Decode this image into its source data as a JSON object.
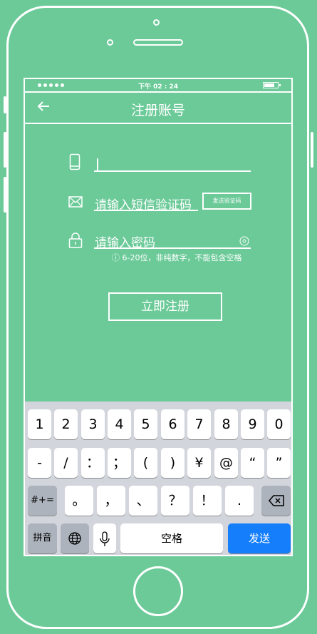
{
  "status_bar": {
    "time": "下午 02 : 24"
  },
  "nav": {
    "title": "注册账号",
    "back_icon": "arrow-left-icon"
  },
  "form": {
    "phone_icon": "phone-icon",
    "sms_icon": "envelope-icon",
    "sms_placeholder": "请输入短信验证码",
    "send_code_label": "发送验证码",
    "lock_icon": "lock-icon",
    "password_placeholder": "请输入密码",
    "eye_icon": "eye-icon",
    "password_hint": "ⓘ 6-20位，非纯数字，不能包含空格",
    "register_label": "立即注册"
  },
  "keyboard": {
    "row1": [
      "1",
      "2",
      "3",
      "4",
      "5",
      "6",
      "7",
      "8",
      "9",
      "0"
    ],
    "row2": [
      "-",
      "/",
      "：",
      "；",
      "(",
      ")",
      "¥",
      "@",
      "“",
      "”"
    ],
    "row3_left": "#+=",
    "row3": [
      "。",
      "，",
      "、",
      "？",
      "！",
      "."
    ],
    "row4_pinyin": "拼音",
    "globe_icon": "globe-icon",
    "mic_icon": "mic-icon",
    "space_label": "空格",
    "send_label": "发送",
    "delete_icon": "backspace-icon"
  },
  "colors": {
    "background": "#6bca98",
    "send_key": "#157efb",
    "keyboard": "#d2d5db"
  }
}
